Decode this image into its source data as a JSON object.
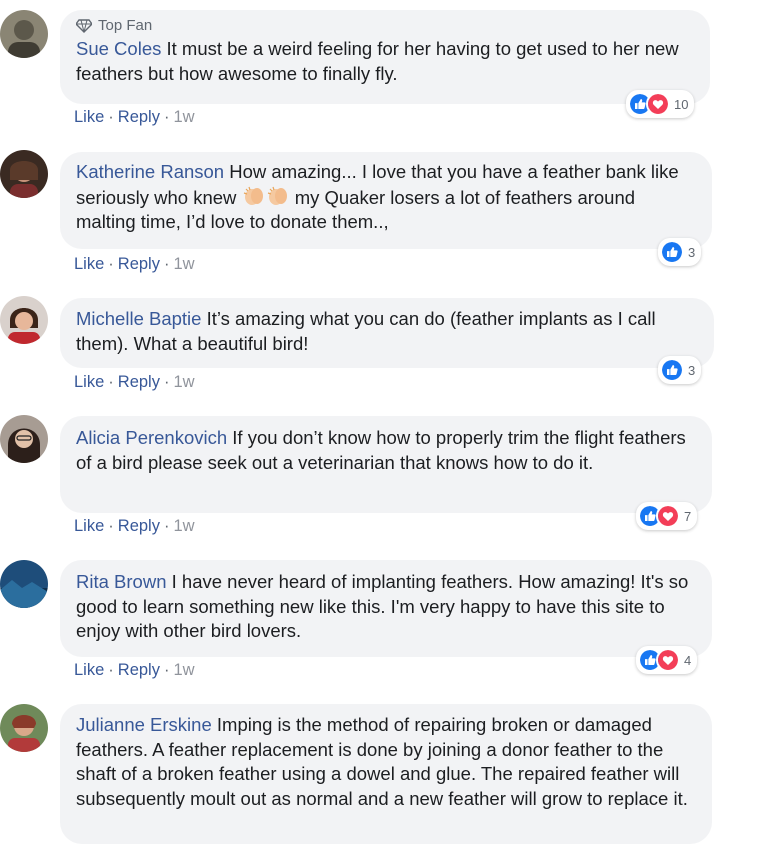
{
  "comments": [
    {
      "badge": "Top Fan",
      "author": "Sue Coles",
      "text": "It must be a weird feeling for her having to get used to her new feathers but how awesome to finally fly.",
      "like": "Like",
      "reply": "Reply",
      "time": "1w",
      "reaction_count": "10",
      "reactions": [
        "like-icon",
        "love-icon"
      ]
    },
    {
      "author": "Katherine Ranson",
      "text_before_emoji": "How amazing... I love that you have a feather bank like seriously who knew",
      "emojis": [
        "clapping-hands-emoji",
        "clapping-hands-emoji"
      ],
      "text_after_emoji": "my Quaker losers a lot of feathers around malting time, I’d love to donate them..,",
      "like": "Like",
      "reply": "Reply",
      "time": "1w",
      "reaction_count": "3",
      "reactions": [
        "like-icon"
      ]
    },
    {
      "author": "Michelle Baptie",
      "text": "It’s amazing what you can do (feather implants as I call them). What a beautiful bird!",
      "like": "Like",
      "reply": "Reply",
      "time": "1w",
      "reaction_count": "3",
      "reactions": [
        "like-icon"
      ]
    },
    {
      "author": "Alicia Perenkovich",
      "text": "If you don’t know how to properly trim the flight feathers of a bird please seek out a veterinarian that knows how to do it.",
      "like": "Like",
      "reply": "Reply",
      "time": "1w",
      "reaction_count": "7",
      "reactions": [
        "like-icon",
        "love-icon"
      ]
    },
    {
      "author": "Rita Brown",
      "text": "I have never heard of implanting feathers. How amazing! It's so good to learn something new like this. I'm very happy to have this site to enjoy with other bird lovers.",
      "like": "Like",
      "reply": "Reply",
      "time": "1w",
      "reaction_count": "4",
      "reactions": [
        "like-icon",
        "love-icon"
      ]
    },
    {
      "author": "Julianne Erskine",
      "text": "Imping is the method of repairing broken or damaged feathers. A feather replacement is done by joining a donor feather to the shaft of a broken feather using a dowel and glue. The repaired feather will subsequently moult out as normal and a new feather will grow to replace it."
    }
  ],
  "separator": "·",
  "colors": {
    "author": "#385898",
    "bubble": "#f2f3f5",
    "like_blue": "#1877f2",
    "love_red": "#f33e58"
  }
}
